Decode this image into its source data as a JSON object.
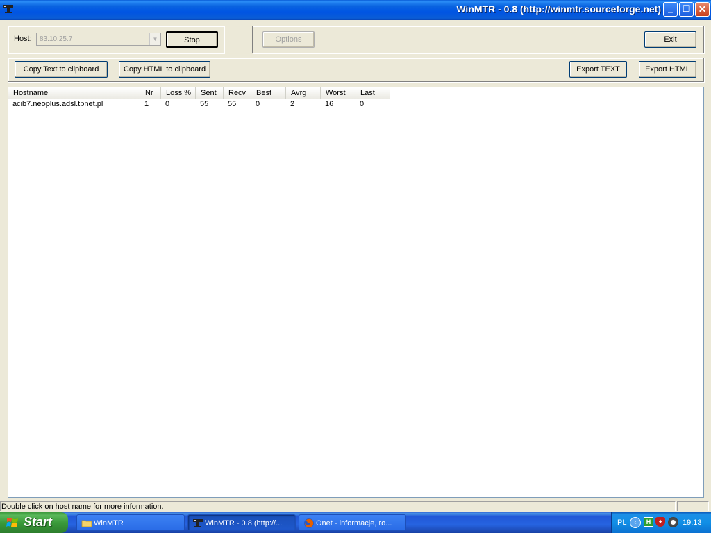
{
  "window": {
    "title": "WinMTR - 0.8 (http://winmtr.sourceforge.net)",
    "icon": "winmtr-icon",
    "controls": {
      "minimize": "_",
      "maximize": "❐",
      "close": "✕"
    }
  },
  "host": {
    "label": "Host:",
    "value": "83.10.25.7"
  },
  "buttons": {
    "stop": "Stop",
    "options": "Options",
    "exit": "Exit",
    "copy_text": "Copy Text to clipboard",
    "copy_html": "Copy HTML to clipboard",
    "export_text": "Export TEXT",
    "export_html": "Export HTML"
  },
  "table": {
    "columns": [
      "Hostname",
      "Nr",
      "Loss %",
      "Sent",
      "Recv",
      "Best",
      "Avrg",
      "Worst",
      "Last"
    ],
    "rows": [
      [
        "acib7.neoplus.adsl.tpnet.pl",
        "1",
        "0",
        "55",
        "55",
        "0",
        "2",
        "16",
        "0"
      ]
    ]
  },
  "status": {
    "text": "Double click on host name for more information."
  },
  "taskbar": {
    "start_label": "Start",
    "tasks": [
      {
        "label": "WinMTR",
        "icon": "folder-icon",
        "active": false
      },
      {
        "label": "WinMTR - 0.8 (http://...",
        "icon": "winmtr-icon",
        "active": true
      },
      {
        "label": "Onet - informacje, ro...",
        "icon": "firefox-icon",
        "active": false
      }
    ],
    "tray": {
      "language": "PL",
      "time": "19:13"
    }
  }
}
